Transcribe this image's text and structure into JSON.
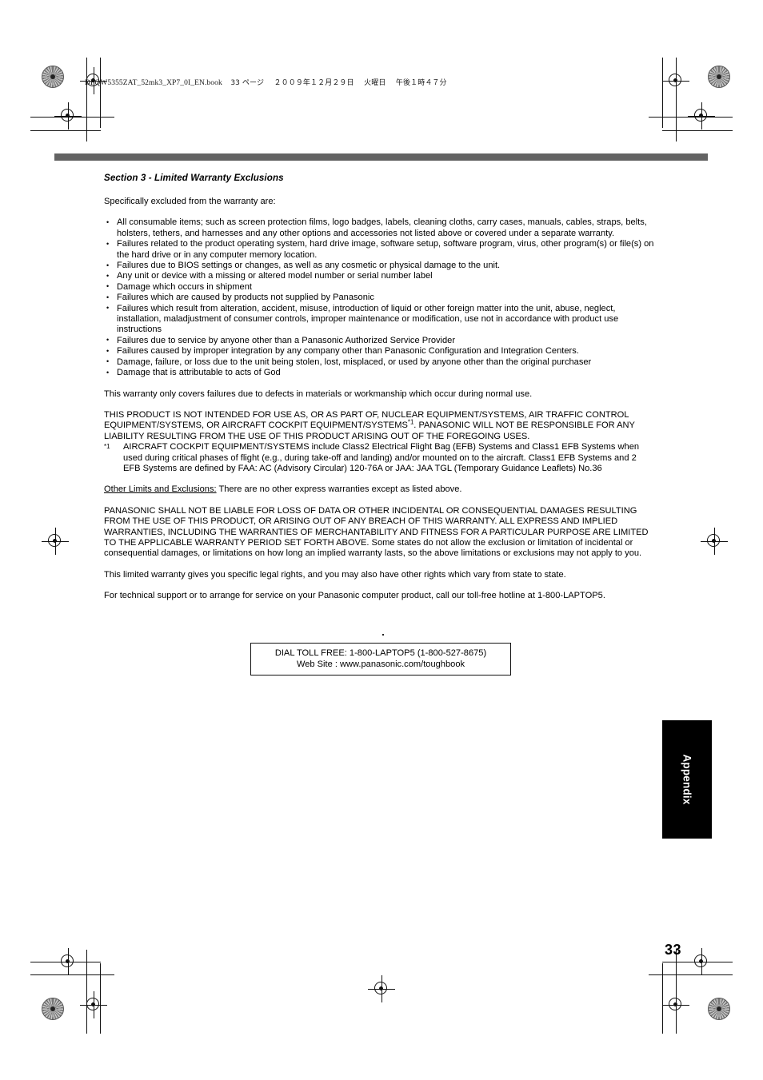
{
  "header": {
    "file_line": "DFQW5355ZAT_52mk3_XP7_0I_EN.book",
    "page_marker": "33 ページ",
    "date": "２００９年１２月２９日",
    "weekday": "火曜日",
    "time": "午後１時４７分"
  },
  "section": {
    "title": "Section 3 - Limited Warranty Exclusions",
    "intro": "Specifically excluded from the warranty are:"
  },
  "exclusions": [
    "All consumable items; such as screen protection films, logo badges, labels, cleaning cloths, carry cases, manuals, cables, straps, belts, holsters, tethers, and harnesses and any other options and accessories not listed above or covered under a separate warranty.",
    "Failures related to the product operating system, hard drive image, software setup, software program, virus, other program(s) or file(s) on the hard drive or in any computer memory location.",
    "Failures due to BIOS settings or changes, as well as any cosmetic or physical damage to the unit.",
    "Any unit or device with a missing or altered model number or serial number label",
    "Damage which occurs in shipment",
    "Failures which are caused by products not supplied by Panasonic",
    "Failures which result from alteration, accident, misuse, introduction of liquid or other foreign matter into the unit, abuse, neglect, installation, maladjustment of consumer controls, improper maintenance or modification, use not in accordance with product use instructions",
    "Failures due to service by anyone other than a Panasonic Authorized Service Provider",
    "Failures caused by improper integration by any company other than Panasonic Configuration and Integration Centers.",
    "Damage, failure, or loss due to the unit being stolen, lost, misplaced, or used by anyone other than the original purchaser",
    "Damage that is attributable to acts of God"
  ],
  "paragraphs": {
    "normal_use": "This warranty only covers failures due to defects in materials or workmanship which occur during normal use.",
    "not_intended_a": "THIS PRODUCT IS NOT INTENDED FOR USE AS, OR AS PART OF, NUCLEAR EQUIPMENT/SYSTEMS, AIR TRAFFIC CONTROL EQUIPMENT/SYSTEMS, OR AIRCRAFT COCKPIT EQUIPMENT/SYSTEMS",
    "not_intended_ref": "*1",
    "not_intended_b": ". PANASONIC WILL NOT BE RESPONSIBLE FOR ANY LIABILITY RESULTING FROM THE USE OF THIS PRODUCT ARISING OUT OF THE FOREGOING USES.",
    "footnote_mark": "*1",
    "footnote_text": "AIRCRAFT COCKPIT EQUIPMENT/SYSTEMS include Class2 Electrical Flight Bag (EFB) Systems and Class1 EFB Systems when used during critical phases of flight (e.g., during take-off and landing) and/or mounted on to the aircraft. Class1 EFB Systems and 2 EFB Systems are defined by FAA: AC (Advisory Circular) 120-76A or JAA: JAA TGL (Temporary Guidance Leaflets) No.36",
    "other_limits_heading": "Other Limits and Exclusions:",
    "other_limits_text": " There are no other express warranties except as listed above.",
    "shall_not_be_liable": "PANASONIC SHALL NOT BE LIABLE FOR LOSS OF DATA OR OTHER INCIDENTAL OR CONSEQUENTIAL DAMAGES RESULTING FROM THE USE OF THIS PRODUCT, OR ARISING OUT OF ANY BREACH OF THIS WARRANTY. ALL EXPRESS AND IMPLIED WARRANTIES, INCLUDING THE WARRANTIES OF MERCHANTABILITY AND FITNESS FOR A PARTICULAR PURPOSE ARE LIMITED TO THE APPLICABLE WARRANTY PERIOD SET FORTH ABOVE. Some states do not allow the exclusion or limitation of incidental or consequential damages, or limitations on how long an implied warranty lasts, so the above limitations or exclusions may not apply to you.",
    "legal_rights": "This limited warranty gives you specific legal rights, and you may also have other rights which vary from state to state.",
    "tech_support": "For technical support or to arrange for service on your Panasonic computer product, call our toll-free hotline at 1-800-LAPTOP5."
  },
  "tollfree_box": {
    "line1": "DIAL TOLL FREE: 1-800-LAPTOP5 (1-800-527-8675)",
    "line2": "Web Site : www.panasonic.com/toughbook"
  },
  "tab": {
    "label": "Appendix"
  },
  "page_number": "33",
  "colors": {
    "rule_gray": "#636363",
    "tab_black": "#000000",
    "text": "#000000"
  }
}
